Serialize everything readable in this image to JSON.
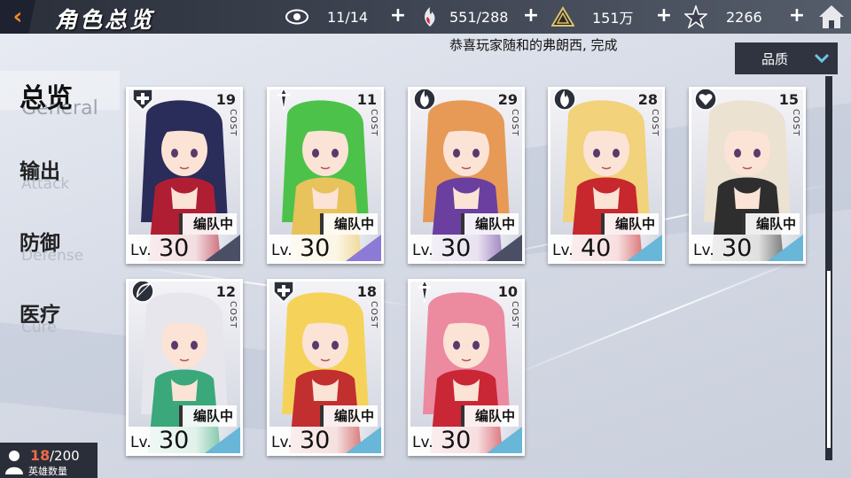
{
  "header": {
    "title": "角色总览",
    "stats": [
      {
        "icon": "eye-icon",
        "value": "11/14"
      },
      {
        "icon": "flame-crystal-icon",
        "value": "551/288"
      },
      {
        "icon": "triangle-emblem-icon",
        "value": "151万"
      },
      {
        "icon": "star-shard-icon",
        "value": "2266"
      }
    ]
  },
  "notice": "恭喜玩家随和的弗朗西, 完成",
  "sort": {
    "label": "品质"
  },
  "categories": [
    {
      "cn": "总览",
      "en": "General"
    },
    {
      "cn": "输出",
      "en": "Attack"
    },
    {
      "cn": "防御",
      "en": "Defense"
    },
    {
      "cn": "医疗",
      "en": "Cure"
    }
  ],
  "cards": [
    {
      "cost": "19",
      "level": "30",
      "class_icon": "shield-cross-icon",
      "status": "编队中",
      "hair": "#2a2c5a",
      "accent": "#b01e34",
      "rarity_color": "#4a4f66"
    },
    {
      "cost": "11",
      "level": "30",
      "class_icon": "sword-icon",
      "status": "编队中",
      "hair": "#4cc24a",
      "accent": "#e8c25a",
      "rarity_color": "#8c7ad6"
    },
    {
      "cost": "29",
      "level": "30",
      "class_icon": "flame-icon",
      "status": "编队中",
      "hair": "#e79a55",
      "accent": "#6a3fa0",
      "rarity_color": "#4a4f66"
    },
    {
      "cost": "28",
      "level": "40",
      "class_icon": "flame-icon",
      "status": "编队中",
      "hair": "#f2d27a",
      "accent": "#c6282e",
      "rarity_color": "#68b6d8"
    },
    {
      "cost": "15",
      "level": "30",
      "class_icon": "heart-wing-icon",
      "status": "编队中",
      "hair": "#ece2d2",
      "accent": "#2e2e2e",
      "rarity_color": "#68b6d8"
    },
    {
      "cost": "12",
      "level": "30",
      "class_icon": "bow-icon",
      "status": "编队中",
      "hair": "#e6e6ec",
      "accent": "#3aa87a",
      "rarity_color": "#68b6d8"
    },
    {
      "cost": "18",
      "level": "30",
      "class_icon": "shield-cross-icon",
      "status": "编队中",
      "hair": "#f5d35a",
      "accent": "#c22f2f",
      "rarity_color": "#68b6d8"
    },
    {
      "cost": "10",
      "level": "30",
      "class_icon": "sword-icon",
      "status": "编队中",
      "hair": "#ec8aa0",
      "accent": "#c92636",
      "rarity_color": "#68b6d8"
    }
  ],
  "card_labels": {
    "cost": "COST",
    "lv": "Lv."
  },
  "hero_count": {
    "current": "18",
    "max": "/200",
    "label": "英雄数量"
  }
}
